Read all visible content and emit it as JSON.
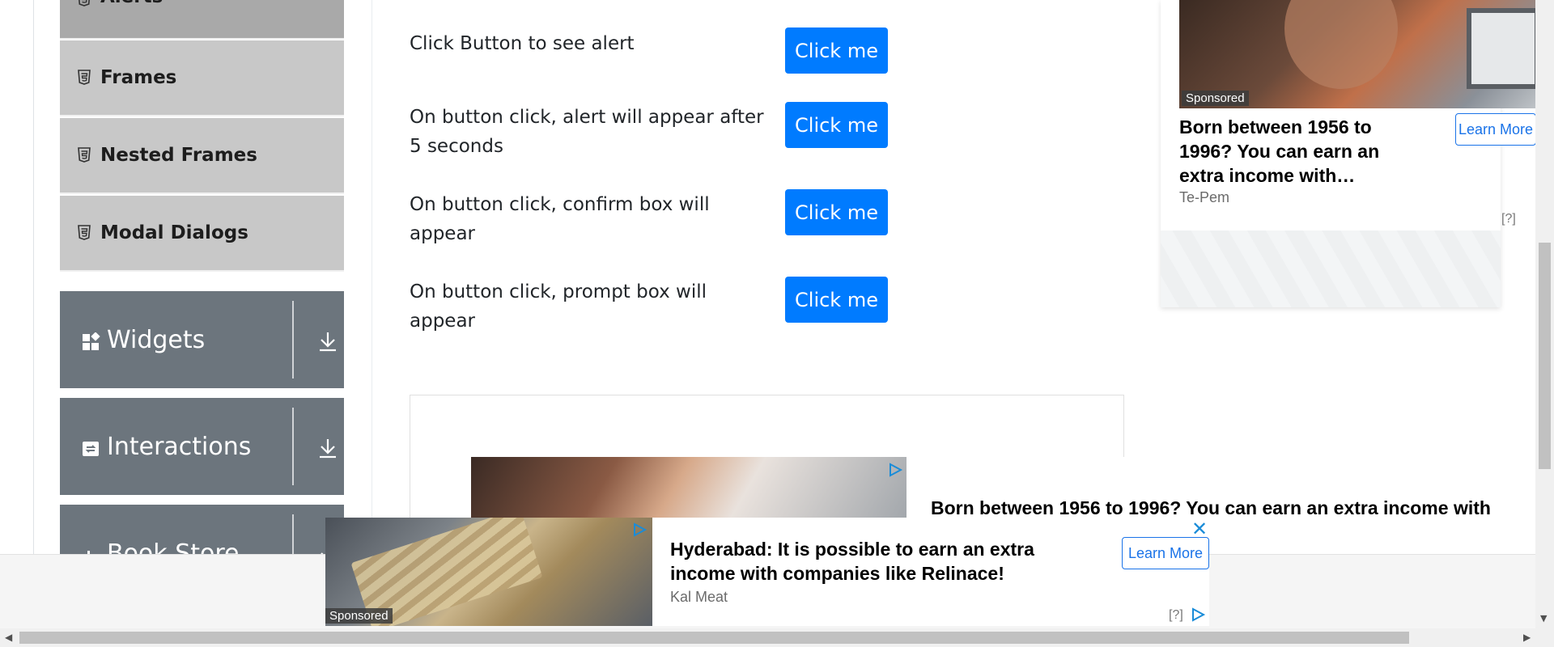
{
  "sidebar": {
    "sub_items": [
      {
        "label": "Alerts"
      },
      {
        "label": "Frames"
      },
      {
        "label": "Nested Frames"
      },
      {
        "label": "Modal Dialogs"
      }
    ],
    "groups": [
      {
        "label": "Widgets",
        "icon": "widgets-icon"
      },
      {
        "label": "Interactions",
        "icon": "interactions-icon"
      },
      {
        "label": "Book Store",
        "icon": "book-store-icon"
      }
    ]
  },
  "alerts": {
    "rows": [
      {
        "text": "Click Button to see alert",
        "button": "Click me"
      },
      {
        "text": "On button click, alert will appear after 5 seconds",
        "button": "Click me"
      },
      {
        "text": "On button click, confirm box will appear",
        "button": "Click me"
      },
      {
        "text": "On button click, prompt box will appear",
        "button": "Click me"
      }
    ]
  },
  "ads": {
    "right": {
      "sponsored": "Sponsored",
      "title": "Born between 1956 to 1996? You can earn an extra income with…",
      "source": "Te-Pem",
      "learn_more": "Learn More",
      "help": "[?]"
    },
    "middle": {
      "title": "Born between 1956 to 1996? You can earn an extra income with"
    },
    "bottom": {
      "sponsored": "Sponsored",
      "title": "Hyderabad: It is possible to earn an extra income with companies like Relinace!",
      "source": "Kal Meat",
      "learn_more": "Learn More",
      "help": "[?]",
      "close": "✕"
    }
  },
  "colors": {
    "primary_button": "#007bff",
    "sidebar_group": "#6c757d",
    "ad_link": "#1a73e8"
  }
}
